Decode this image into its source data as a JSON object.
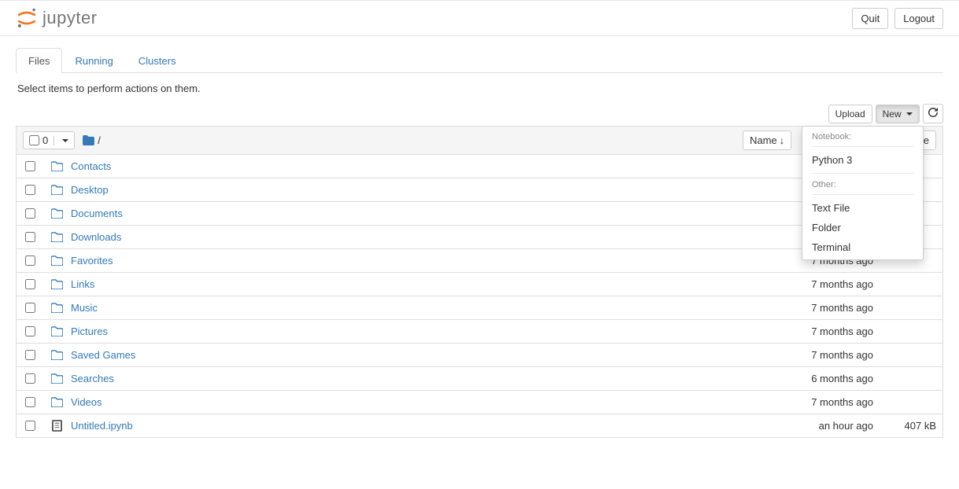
{
  "header": {
    "logo_text": "jupyter",
    "quit_label": "Quit",
    "logout_label": "Logout"
  },
  "tabs": [
    {
      "label": "Files",
      "active": true
    },
    {
      "label": "Running",
      "active": false
    },
    {
      "label": "Clusters",
      "active": false
    }
  ],
  "instructions": "Select items to perform actions on them.",
  "toolbar": {
    "upload_label": "Upload",
    "new_label": "New"
  },
  "dropdown": {
    "notebook_header": "Notebook:",
    "notebook_items": [
      "Python 3"
    ],
    "other_header": "Other:",
    "other_items": [
      "Text File",
      "Folder",
      "Terminal"
    ]
  },
  "list_header": {
    "selected_count": "0",
    "breadcrumb_sep": "/",
    "name_label": "Name",
    "last_modified_suffix": "te"
  },
  "files": [
    {
      "type": "folder",
      "name": "Contacts",
      "modified": "",
      "size": ""
    },
    {
      "type": "folder",
      "name": "Desktop",
      "modified": "",
      "size": ""
    },
    {
      "type": "folder",
      "name": "Documents",
      "modified": "",
      "size": ""
    },
    {
      "type": "folder",
      "name": "Downloads",
      "modified": "",
      "size": ""
    },
    {
      "type": "folder",
      "name": "Favorites",
      "modified": "7 months ago",
      "size": ""
    },
    {
      "type": "folder",
      "name": "Links",
      "modified": "7 months ago",
      "size": ""
    },
    {
      "type": "folder",
      "name": "Music",
      "modified": "7 months ago",
      "size": ""
    },
    {
      "type": "folder",
      "name": "Pictures",
      "modified": "7 months ago",
      "size": ""
    },
    {
      "type": "folder",
      "name": "Saved Games",
      "modified": "7 months ago",
      "size": ""
    },
    {
      "type": "folder",
      "name": "Searches",
      "modified": "6 months ago",
      "size": ""
    },
    {
      "type": "folder",
      "name": "Videos",
      "modified": "7 months ago",
      "size": ""
    },
    {
      "type": "notebook",
      "name": "Untitled.ipynb",
      "modified": "an hour ago",
      "size": "407 kB"
    }
  ]
}
